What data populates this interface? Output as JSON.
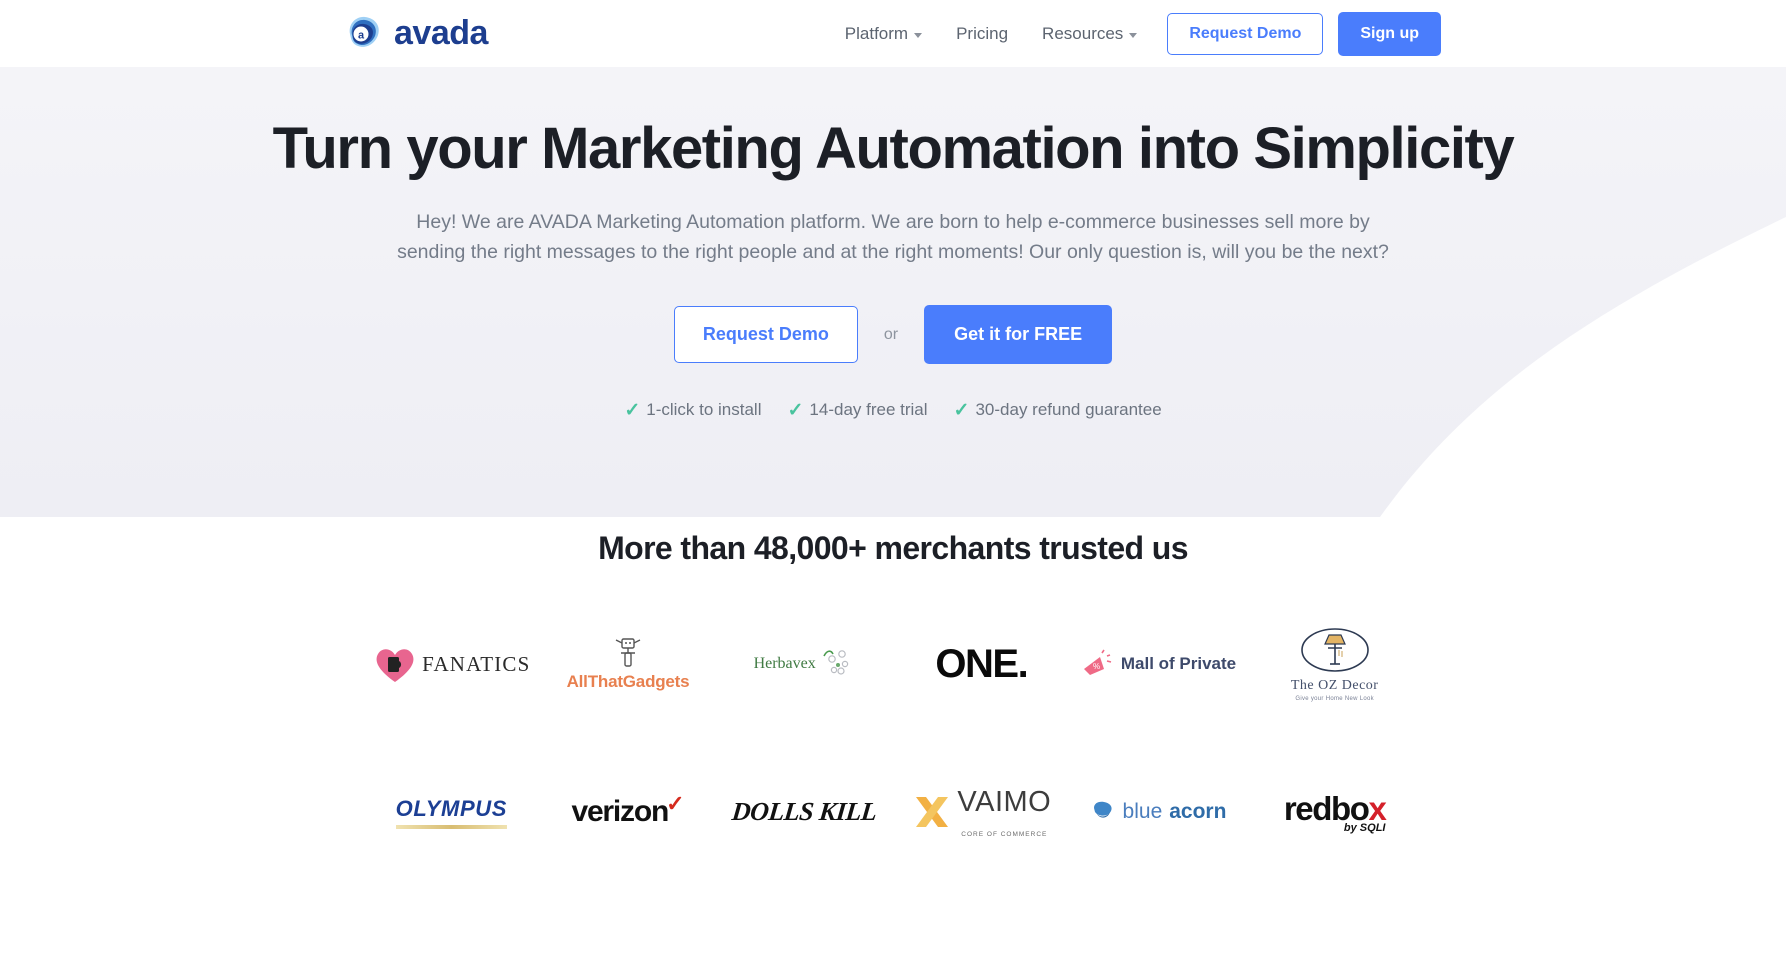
{
  "header": {
    "brand": {
      "name": "avada",
      "icon": "avada-logo-icon"
    },
    "nav": [
      {
        "label": "Platform",
        "has_caret": true
      },
      {
        "label": "Pricing",
        "has_caret": false
      },
      {
        "label": "Resources",
        "has_caret": true
      }
    ],
    "request_demo_label": "Request Demo",
    "signup_label": "Sign up"
  },
  "hero": {
    "headline": "Turn your Marketing Automation into Simplicity",
    "paragraph": "Hey! We are AVADA Marketing Automation platform. We are born to help e-commerce businesses sell more by sending the right messages to the right people and at the right moments! Our only question is, will you be the next?",
    "request_demo_label": "Request Demo",
    "or_label": "or",
    "get_free_label": "Get it for FREE",
    "features": [
      "1-click to install",
      "14-day free trial",
      "30-day refund guarantee"
    ]
  },
  "trust": {
    "heading": "More than 48,000+ merchants trusted us",
    "logos": [
      {
        "name": "FANATICS",
        "sub": ""
      },
      {
        "name": "AllThatGadgets",
        "sub": ""
      },
      {
        "name": "Herbavex",
        "sub": ""
      },
      {
        "name": "ONE.",
        "sub": ""
      },
      {
        "name": "Mall of Private",
        "sub": ""
      },
      {
        "name": "The OZ Decor",
        "sub": "Give your Home New Look"
      },
      {
        "name": "OLYMPUS",
        "sub": ""
      },
      {
        "name": "verizon",
        "sub": ""
      },
      {
        "name": "DOLLS KILL",
        "sub": ""
      },
      {
        "name": "VAIMO",
        "sub": "CORE OF COMMERCE"
      },
      {
        "name": "blue",
        "sub": "acorn"
      },
      {
        "name": "redbo",
        "sub": "by SQLI"
      }
    ]
  },
  "colors": {
    "accent": "#4a7dfc",
    "brand_navy": "#1d3e8f",
    "tick_green": "#49c39e",
    "hero_bg": "#f2f2f7",
    "text_dark": "#1c1f26",
    "text_muted": "#747c89"
  }
}
